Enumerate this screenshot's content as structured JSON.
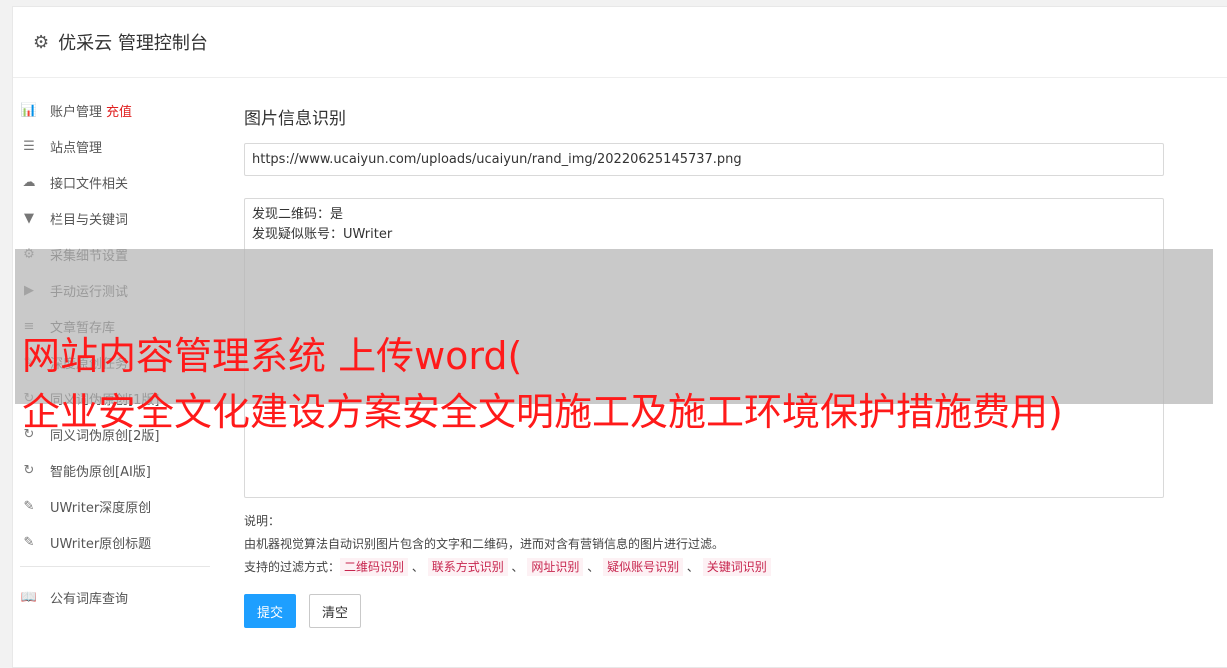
{
  "header": {
    "title": "优采云 管理控制台",
    "icon": "gear-icon"
  },
  "sidebar": {
    "items": [
      {
        "label": "账户管理",
        "extra": "充值",
        "icon": "bar-chart-icon",
        "glyph": "📊"
      },
      {
        "label": "站点管理",
        "icon": "server-icon",
        "glyph": "☰"
      },
      {
        "label": "接口文件相关",
        "icon": "cloud-upload-icon",
        "glyph": "☁"
      },
      {
        "label": "栏目与关键词",
        "icon": "filter-icon",
        "glyph": "▼"
      },
      {
        "label": "采集细节设置",
        "icon": "cogs-icon",
        "glyph": "⚙"
      },
      {
        "label": "手动运行测试",
        "icon": "play-circle-icon",
        "glyph": "▶"
      },
      {
        "label": "文章暂存库",
        "icon": "database-icon",
        "glyph": "≡"
      },
      {
        "label": "深度原创任务",
        "icon": "edit-icon",
        "glyph": "✎"
      },
      {
        "label": "同义词伪原创[1版]",
        "icon": "refresh-icon",
        "glyph": "↻"
      },
      {
        "label": "同义词伪原创[2版]",
        "icon": "refresh-icon",
        "glyph": "↻"
      },
      {
        "label": "智能伪原创[AI版]",
        "icon": "refresh-icon",
        "glyph": "↻"
      },
      {
        "label": "UWriter深度原创",
        "icon": "edit-icon",
        "glyph": "✎"
      },
      {
        "label": "UWriter原创标题",
        "icon": "edit-icon",
        "glyph": "✎"
      }
    ],
    "bottom_items": [
      {
        "label": "公有词库查询",
        "icon": "book-icon",
        "glyph": "📖"
      }
    ]
  },
  "main": {
    "title": "图片信息识别",
    "url_value": "https://www.ucaiyun.com/uploads/ucaiyun/rand_img/20220625145737.png",
    "result_lines": [
      "发现二维码：是",
      "发现疑似账号：UWriter"
    ],
    "desc_title": "说明：",
    "desc_text": "由机器视觉算法自动识别图片包含的文字和二维码，进而对含有营销信息的图片进行过滤。",
    "filter_label": "支持的过滤方式：",
    "filter_tags": [
      "二维码识别",
      "联系方式识别",
      "网址识别",
      "疑似账号识别",
      "关键词识别"
    ],
    "separator": "、",
    "submit_label": "提交",
    "clear_label": "清空"
  },
  "overlay": {
    "line1": "网站内容管理系统 上传word(",
    "line2": "企业安全文化建设方案安全文明施工及施工环境保护措施费用)",
    "color": "#ff1a1a"
  }
}
